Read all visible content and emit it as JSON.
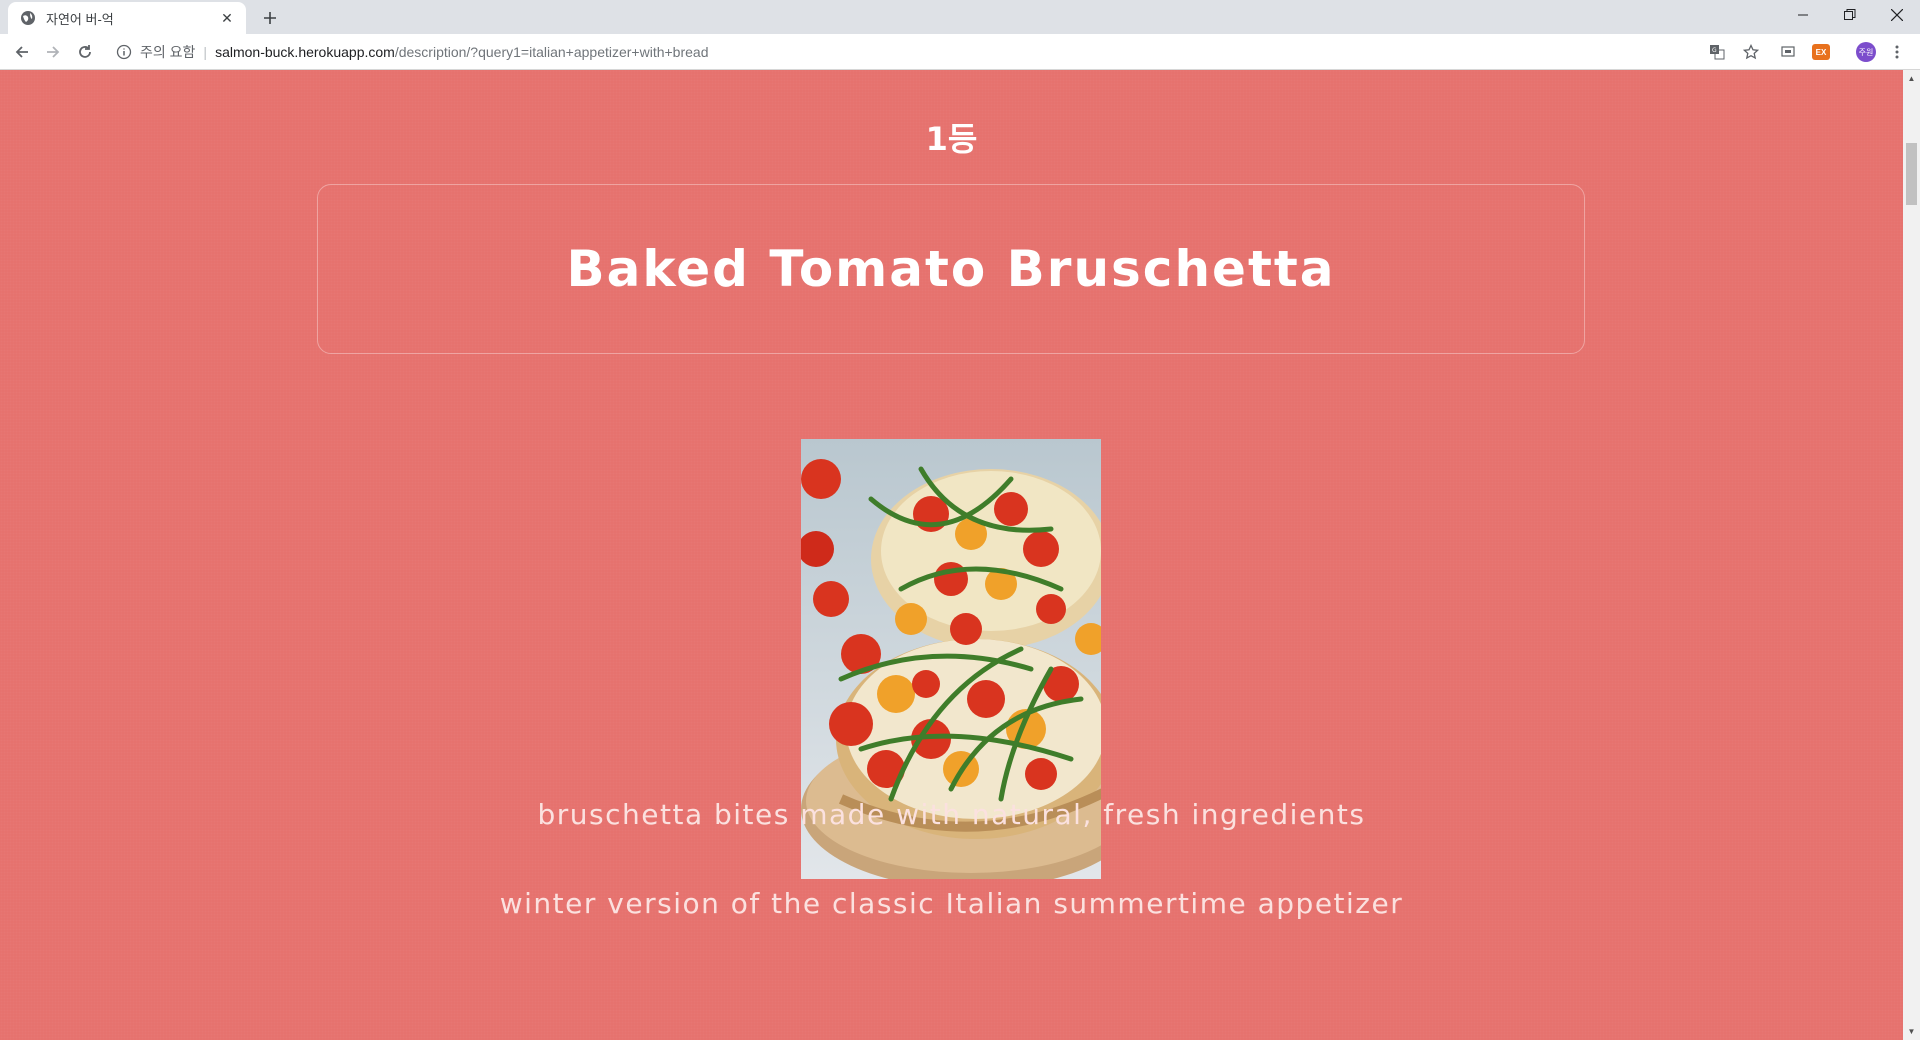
{
  "browser": {
    "tab_title": "자연어 버-억",
    "security_label": "주의 요함",
    "url_host": "salmon-buck.herokuapp.com",
    "url_path": "/description/?query1=italian+appetizer+with+bread",
    "profile_initials": "주원",
    "extension_badge": "EX"
  },
  "page": {
    "rank_label": "1등",
    "recipe_title": "Baked Tomato Bruschetta",
    "descriptions": [
      "bruschetta bites made with natural, fresh ingredients",
      "winter version of the classic Italian summertime appetizer"
    ],
    "image_subject": "bruschetta-photo"
  },
  "colors": {
    "page_background": "#e6726e",
    "title_text": "#ffffff",
    "description_text": "#fbe1df"
  }
}
